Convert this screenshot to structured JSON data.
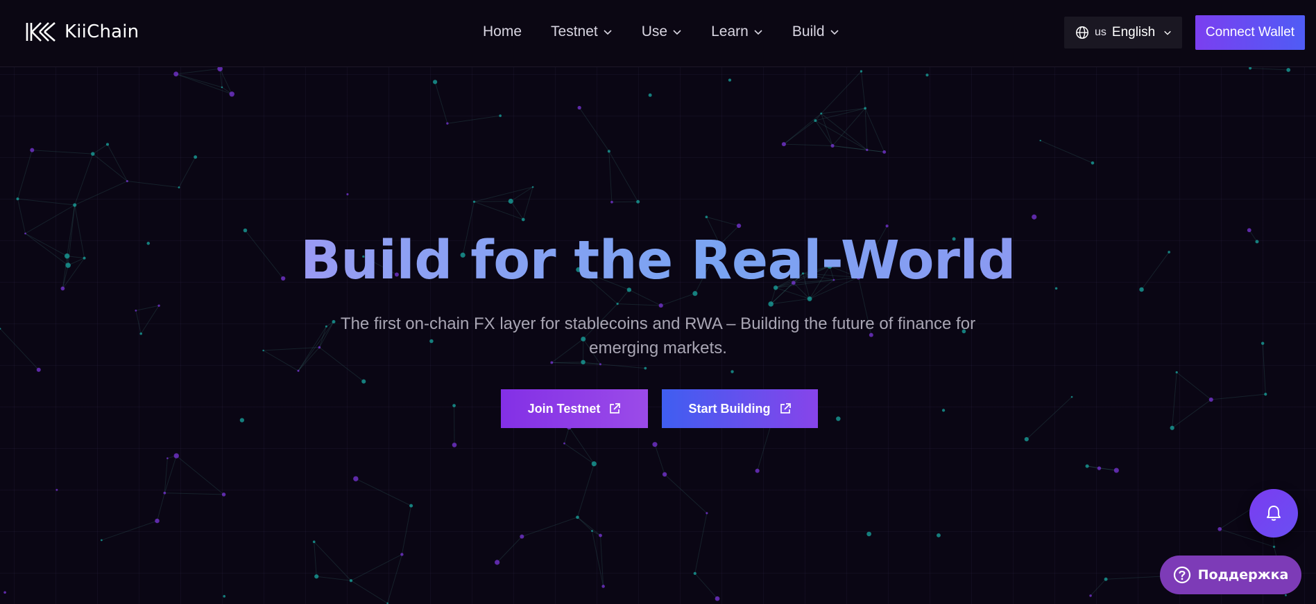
{
  "header": {
    "logo_text": "KiiChain",
    "nav": [
      {
        "label": "Home",
        "dropdown": false
      },
      {
        "label": "Testnet",
        "dropdown": true
      },
      {
        "label": "Use",
        "dropdown": true
      },
      {
        "label": "Learn",
        "dropdown": true
      },
      {
        "label": "Build",
        "dropdown": true
      }
    ],
    "language": {
      "code": "us",
      "label": "English"
    },
    "connect_wallet": "Connect Wallet"
  },
  "hero": {
    "title": "Build for the Real-World",
    "subtitle": "The first on-chain FX layer for stablecoins and RWA – Building the future of finance for emerging markets.",
    "buttons": {
      "join_testnet": "Join Testnet",
      "start_building": "Start Building"
    }
  },
  "widgets": {
    "support_label": "Поддержка"
  },
  "icons": [
    "kiichain-logo-icon",
    "globe-icon",
    "chevron-down-icon",
    "external-link-icon",
    "bell-icon",
    "help-circle-icon"
  ],
  "colors": {
    "background": "#0a0614",
    "accent_purple": "#7b3ff0",
    "accent_blue": "#4f5cf5",
    "support_bg": "#7d3bb7"
  }
}
